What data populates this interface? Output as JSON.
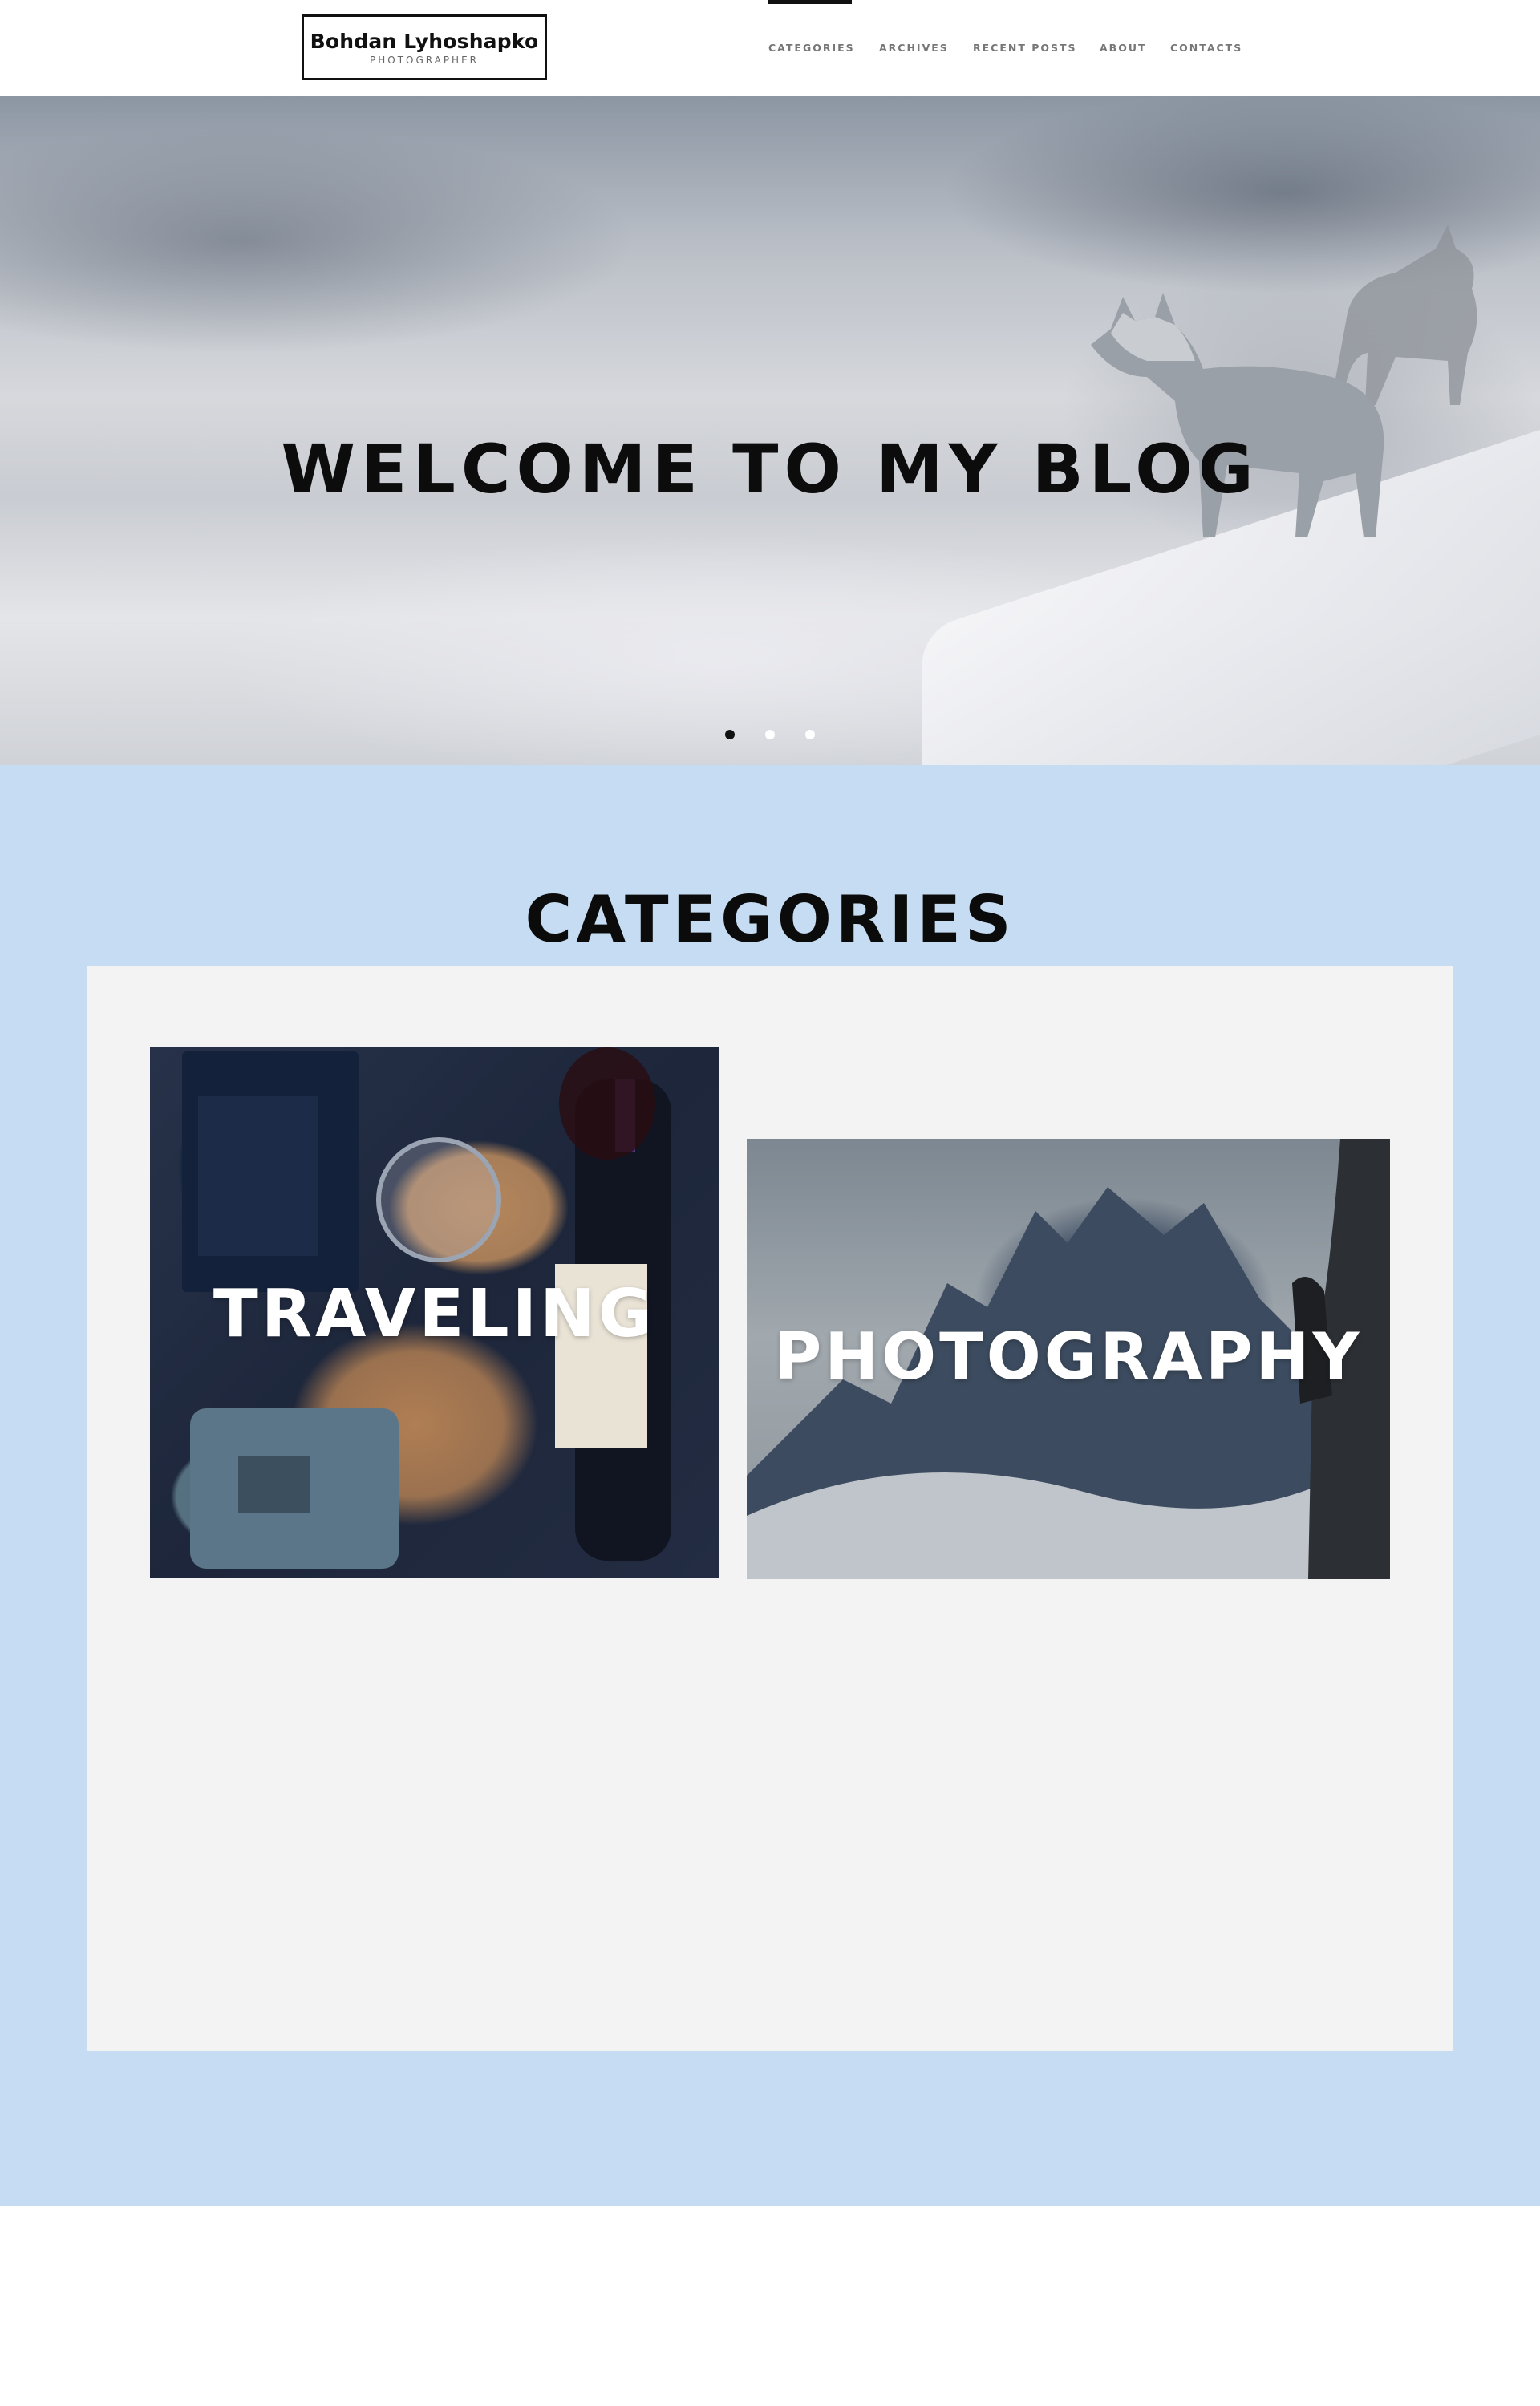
{
  "header": {
    "logo": {
      "name": "Bohdan Lyhoshapko",
      "subtitle": "PHOTOGRAPHER"
    },
    "nav": [
      {
        "label": "CATEGORIES",
        "active": true
      },
      {
        "label": "ARCHIVES",
        "active": false
      },
      {
        "label": "RECENT POSTS",
        "active": false
      },
      {
        "label": "ABOUT",
        "active": false
      },
      {
        "label": "CONTACTS",
        "active": false
      }
    ]
  },
  "hero": {
    "title": "WELCOME TO MY BLOG",
    "slider": {
      "slides": 3,
      "active_index": 0
    }
  },
  "categories": {
    "heading": "CATEGORIES",
    "items": [
      {
        "label": "TRAVELING"
      },
      {
        "label": "PHOTOGRAPHY"
      }
    ]
  },
  "colors": {
    "section_bg": "#c5dcf2",
    "panel_bg": "#f3f3f3",
    "text_dark": "#0c0c0c",
    "nav_text": "#777777"
  }
}
